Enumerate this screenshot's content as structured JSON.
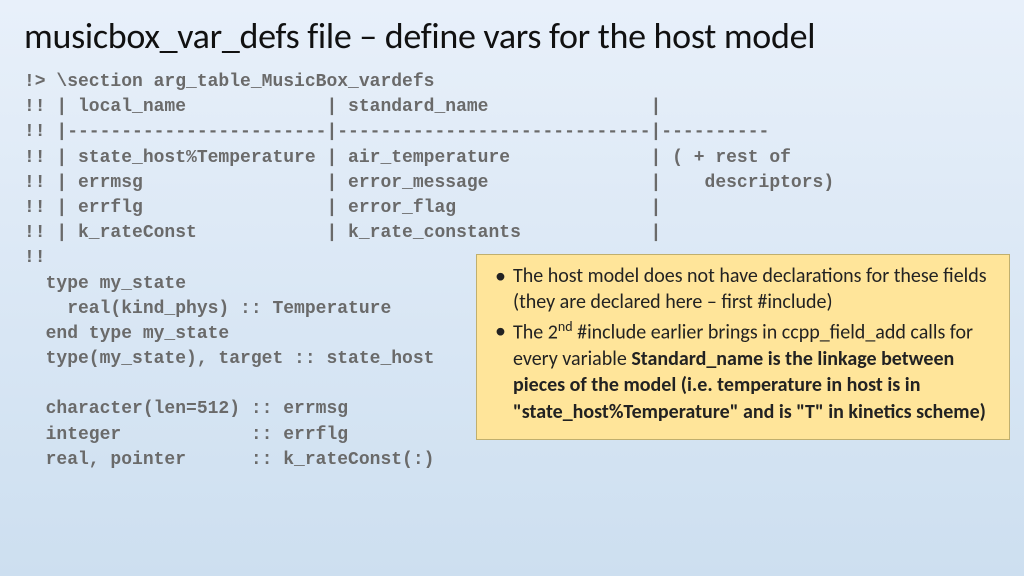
{
  "title": "musicbox_var_defs file – define vars for the host model",
  "code": {
    "l01": "!> \\section arg_table_MusicBox_vardefs",
    "l02": "!! | local_name             | standard_name               |",
    "l03": "!! |------------------------|-----------------------------|----------",
    "l04": "!! | state_host%Temperature | air_temperature             | ( + rest of",
    "l05": "!! | errmsg                 | error_message               |    descriptors)",
    "l06": "!! | errflg                 | error_flag                  |",
    "l07": "!! | k_rateConst            | k_rate_constants            |",
    "l08": "!!",
    "l09": "  type my_state",
    "l10": "    real(kind_phys) :: Temperature",
    "l11": "  end type my_state",
    "l12": "  type(my_state), target :: state_host",
    "l13": "",
    "l14": "  character(len=512) :: errmsg",
    "l15": "  integer            :: errflg",
    "l16": "  real, pointer      :: k_rateConst(:)"
  },
  "callout": {
    "b1a": "The host model does not have declarations for these fields (they are declared here – first #include)",
    "b2a": "The 2",
    "b2sup": "nd",
    "b2b": " #include earlier brings in ccpp_field_add calls for every variable ",
    "b2bold": "Standard_name is the linkage between pieces of the model  (i.e. temperature in host is in \"state_host%Temperature\" and is \"T\" in kinetics scheme)"
  }
}
